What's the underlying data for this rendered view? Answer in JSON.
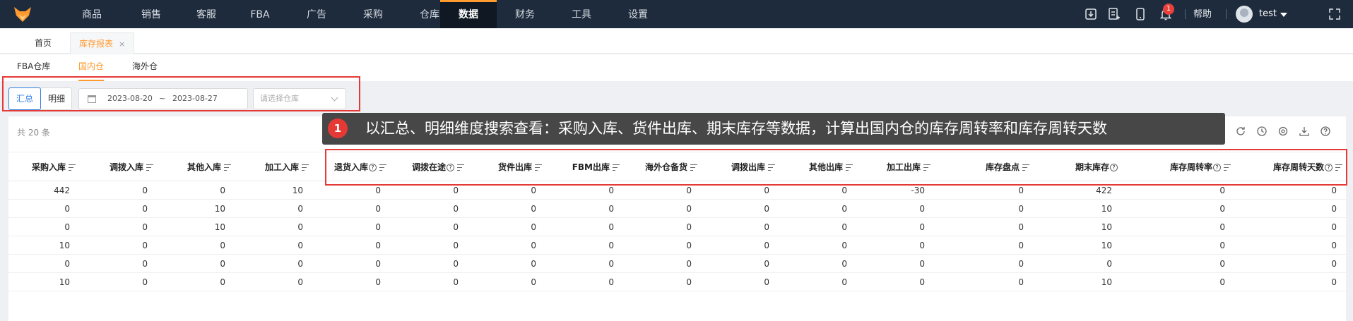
{
  "nav": {
    "items": [
      "商品",
      "销售",
      "客服",
      "FBA",
      "广告",
      "采购",
      "仓库",
      "数据",
      "财务",
      "工具",
      "设置"
    ],
    "active": "数据",
    "notification_count": "1",
    "help": "帮助",
    "user": "test"
  },
  "tabs": [
    {
      "label": "首页"
    },
    {
      "label": "库存报表",
      "close": "×"
    }
  ],
  "subtabs": [
    "FBA仓库",
    "国内仓",
    "海外仓"
  ],
  "filters": {
    "mode_summary": "汇总",
    "mode_detail": "明细",
    "date_start": "2023-08-20",
    "date_sep": "~",
    "date_end": "2023-08-27",
    "warehouse_placeholder": "请选择仓库"
  },
  "table": {
    "count_text": "共 20 条",
    "columns": [
      "采购入库",
      "调拨入库",
      "其他入库",
      "加工入库",
      "退货入库",
      "调拨在途",
      "货件出库",
      "FBM出库",
      "海外仓备货",
      "调拨出库",
      "其他出库",
      "加工出库",
      "库存盘点",
      "期末库存",
      "库存周转率",
      "库存周转天数"
    ],
    "rows": [
      [
        "442",
        "0",
        "0",
        "10",
        "0",
        "0",
        "0",
        "0",
        "0",
        "0",
        "0",
        "-30",
        "0",
        "422",
        "0",
        "0"
      ],
      [
        "0",
        "0",
        "10",
        "0",
        "0",
        "0",
        "0",
        "0",
        "0",
        "0",
        "0",
        "0",
        "0",
        "10",
        "0",
        "0"
      ],
      [
        "0",
        "0",
        "10",
        "0",
        "0",
        "0",
        "0",
        "0",
        "0",
        "0",
        "0",
        "0",
        "0",
        "10",
        "0",
        "0"
      ],
      [
        "10",
        "0",
        "0",
        "0",
        "0",
        "0",
        "0",
        "0",
        "0",
        "0",
        "0",
        "0",
        "0",
        "10",
        "0",
        "0"
      ],
      [
        "0",
        "0",
        "0",
        "0",
        "0",
        "0",
        "0",
        "0",
        "0",
        "0",
        "0",
        "0",
        "0",
        "0",
        "0",
        "0"
      ],
      [
        "10",
        "0",
        "0",
        "0",
        "0",
        "0",
        "0",
        "0",
        "0",
        "0",
        "0",
        "0",
        "0",
        "10",
        "0",
        "0"
      ]
    ]
  },
  "annotation": {
    "number": "1",
    "text": "以汇总、明细维度搜索查看：采购入库、货件出库、期末库存等数据，计算出国内仓的库存周转率和库存周转天数"
  },
  "colors": {
    "nav_bg": "#1e2b3c",
    "accent": "#ff9a2e",
    "primary": "#2f7de1",
    "highlight": "#e53935"
  }
}
